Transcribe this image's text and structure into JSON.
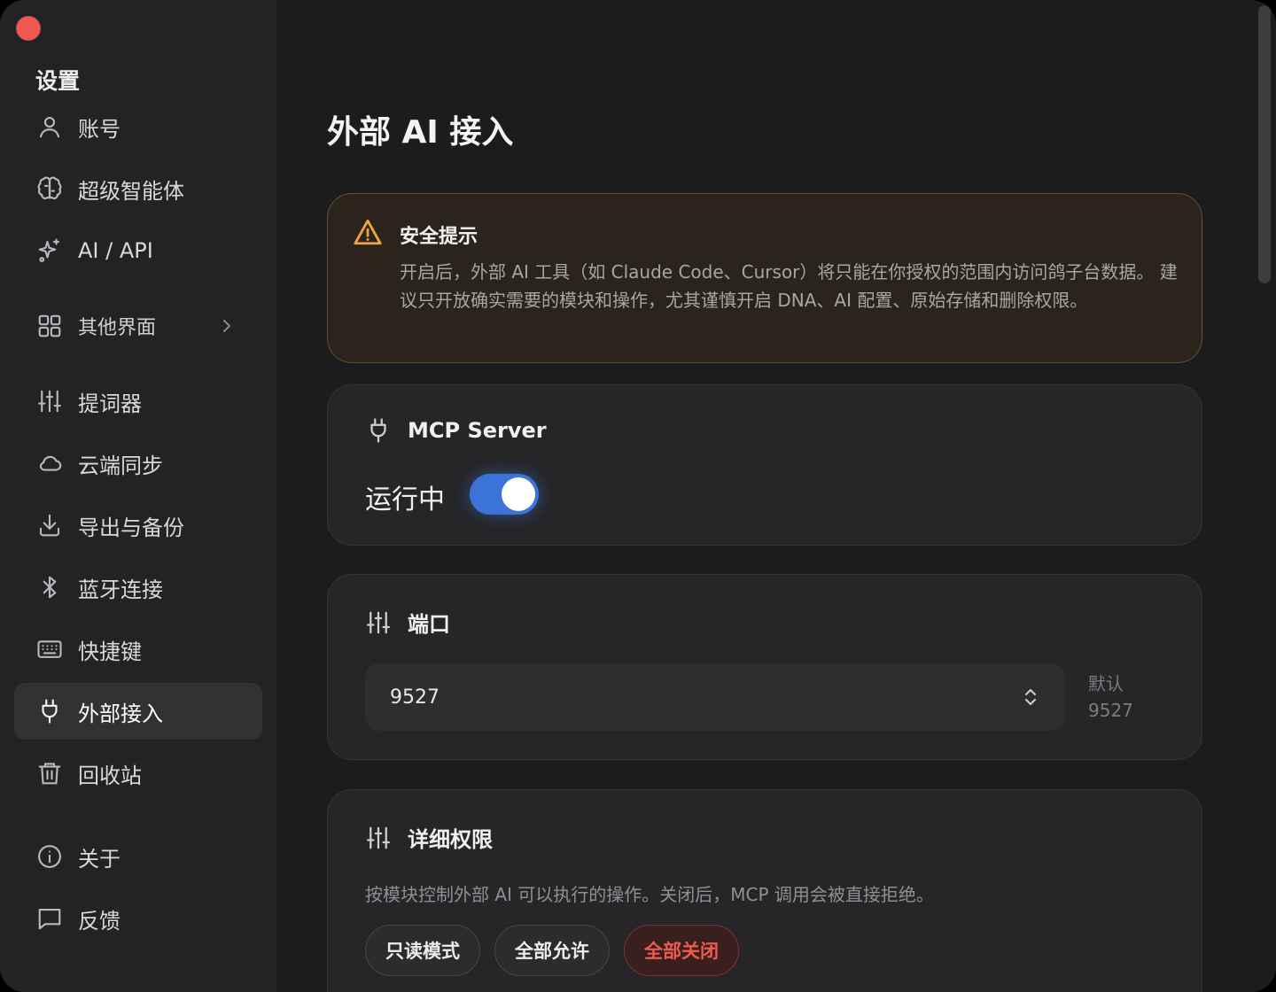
{
  "sidebar": {
    "title": "设置",
    "items": [
      {
        "label": "账号"
      },
      {
        "label": "超级智能体"
      },
      {
        "label": "AI / API"
      },
      {
        "label": "其他界面"
      },
      {
        "label": "提词器"
      },
      {
        "label": "云端同步"
      },
      {
        "label": "导出与备份"
      },
      {
        "label": "蓝牙连接"
      },
      {
        "label": "快捷键"
      },
      {
        "label": "外部接入"
      },
      {
        "label": "回收站"
      },
      {
        "label": "关于"
      },
      {
        "label": "反馈"
      }
    ],
    "active_index": 9
  },
  "main": {
    "title": "外部 AI 接入",
    "warning": {
      "title": "安全提示",
      "body": "开启后，外部 AI 工具（如 Claude Code、Cursor）将只能在你授权的范围内访问鸽子台数据。 建议只开放确实需要的模块和操作，尤其谨慎开启 DNA、AI 配置、原始存储和删除权限。"
    },
    "mcp": {
      "title": "MCP Server",
      "status": "运行中",
      "enabled": true
    },
    "port": {
      "title": "端口",
      "value": "9527",
      "default_label": "默认",
      "default_value": "9527"
    },
    "permissions": {
      "title": "详细权限",
      "description": "按模块控制外部 AI 可以执行的操作。关闭后，MCP 调用会被直接拒绝。",
      "buttons": {
        "readonly": "只读模式",
        "allow_all": "全部允许",
        "close_all": "全部关闭"
      }
    }
  },
  "colors": {
    "accent": "#3c73d8",
    "warning": "#f0a43a",
    "danger": "#ee5a4f"
  }
}
